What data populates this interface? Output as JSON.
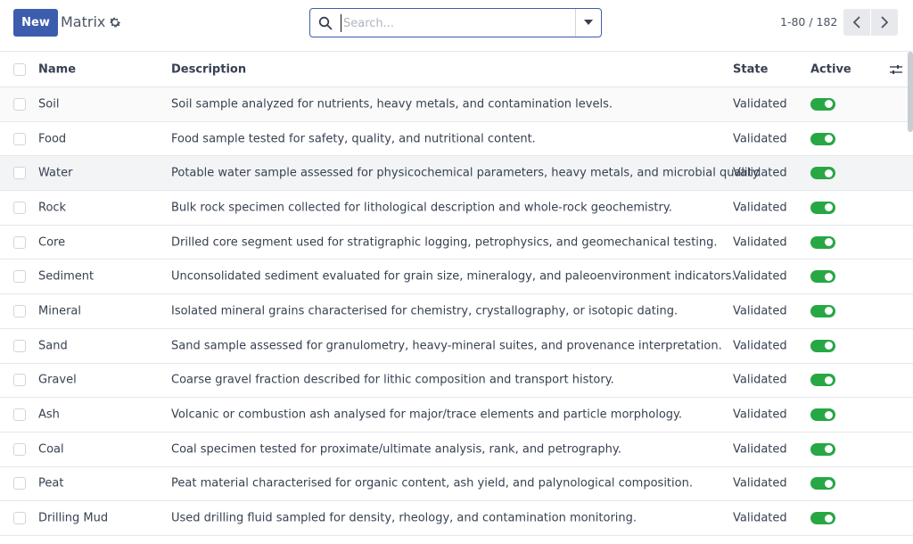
{
  "control_panel": {
    "new_label": "New",
    "title": "Matrix",
    "search_placeholder": "Search...",
    "pager_value": "1-80 / 182"
  },
  "columns": {
    "name": "Name",
    "description": "Description",
    "state": "State",
    "active": "Active"
  },
  "rows": [
    {
      "name": "Soil",
      "description": "Soil sample analyzed for nutrients, heavy metals, and contamination levels.",
      "state": "Validated",
      "active": true
    },
    {
      "name": "Food",
      "description": "Food sample tested for safety, quality, and nutritional content.",
      "state": "Validated",
      "active": true
    },
    {
      "name": "Water",
      "description": "Potable water sample assessed for physicochemical parameters, heavy metals, and microbial quality.",
      "state": "Validated",
      "active": true
    },
    {
      "name": "Rock",
      "description": "Bulk rock specimen collected for lithological description and whole-rock geochemistry.",
      "state": "Validated",
      "active": true
    },
    {
      "name": "Core",
      "description": "Drilled core segment used for stratigraphic logging, petrophysics, and geomechanical testing.",
      "state": "Validated",
      "active": true
    },
    {
      "name": "Sediment",
      "description": "Unconsolidated sediment evaluated for grain size, mineralogy, and paleoenvironment indicators.",
      "state": "Validated",
      "active": true
    },
    {
      "name": "Mineral",
      "description": "Isolated mineral grains characterised for chemistry, crystallography, or isotopic dating.",
      "state": "Validated",
      "active": true
    },
    {
      "name": "Sand",
      "description": "Sand sample assessed for granulometry, heavy-mineral suites, and provenance interpretation.",
      "state": "Validated",
      "active": true
    },
    {
      "name": "Gravel",
      "description": "Coarse gravel fraction described for lithic composition and transport history.",
      "state": "Validated",
      "active": true
    },
    {
      "name": "Ash",
      "description": "Volcanic or combustion ash analysed for major/trace elements and particle morphology.",
      "state": "Validated",
      "active": true
    },
    {
      "name": "Coal",
      "description": "Coal specimen tested for proximate/ultimate analysis, rank, and petrography.",
      "state": "Validated",
      "active": true
    },
    {
      "name": "Peat",
      "description": "Peat material characterised for organic content, ash yield, and palynological composition.",
      "state": "Validated",
      "active": true
    },
    {
      "name": "Drilling Mud",
      "description": "Used drilling fluid sampled for density, rheology, and contamination monitoring.",
      "state": "Validated",
      "active": true
    }
  ],
  "colors": {
    "primary": "#3c5cae",
    "toggle_on": "#28a745"
  }
}
